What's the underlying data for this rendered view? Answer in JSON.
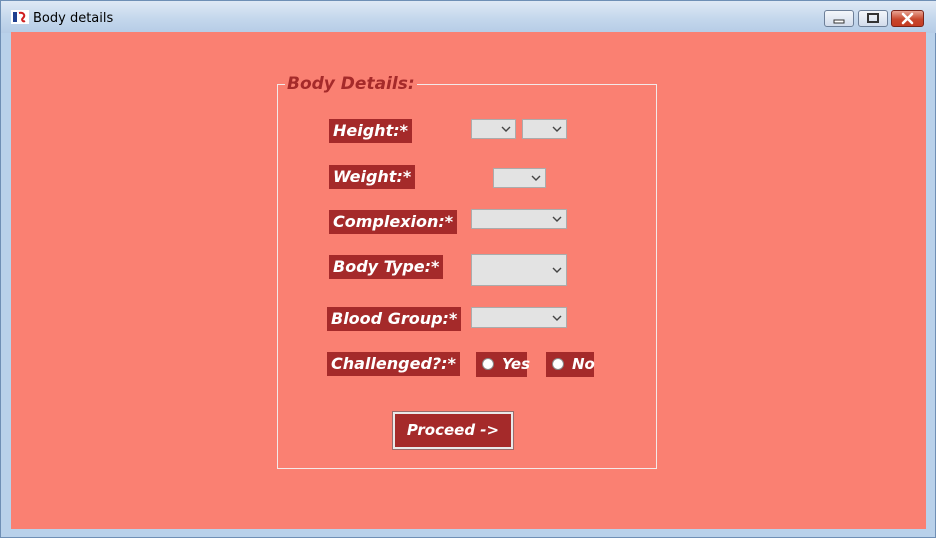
{
  "window": {
    "title": "Body details",
    "icon": "app-icon",
    "controls": [
      "minimize-icon",
      "maximize-icon",
      "close-icon"
    ]
  },
  "form": {
    "group_title": "Body Details:",
    "fields": {
      "height": {
        "label": "Height:*",
        "value_feet": "",
        "value_inches": ""
      },
      "weight": {
        "label": "Weight:*",
        "value": ""
      },
      "complexion": {
        "label": "Complexion:*",
        "value": ""
      },
      "body_type": {
        "label": "Body Type:*",
        "value": ""
      },
      "blood_group": {
        "label": "Blood Group:*",
        "value": ""
      },
      "challenged": {
        "label": "Challenged?:*",
        "option_yes": "Yes",
        "option_no": "No",
        "selected": ""
      }
    },
    "proceed_label": "Proceed ->"
  },
  "colors": {
    "background": "#fa8072",
    "label_bg": "#a52a2a",
    "label_text": "#ffffff",
    "group_title": "#a52a2a"
  }
}
